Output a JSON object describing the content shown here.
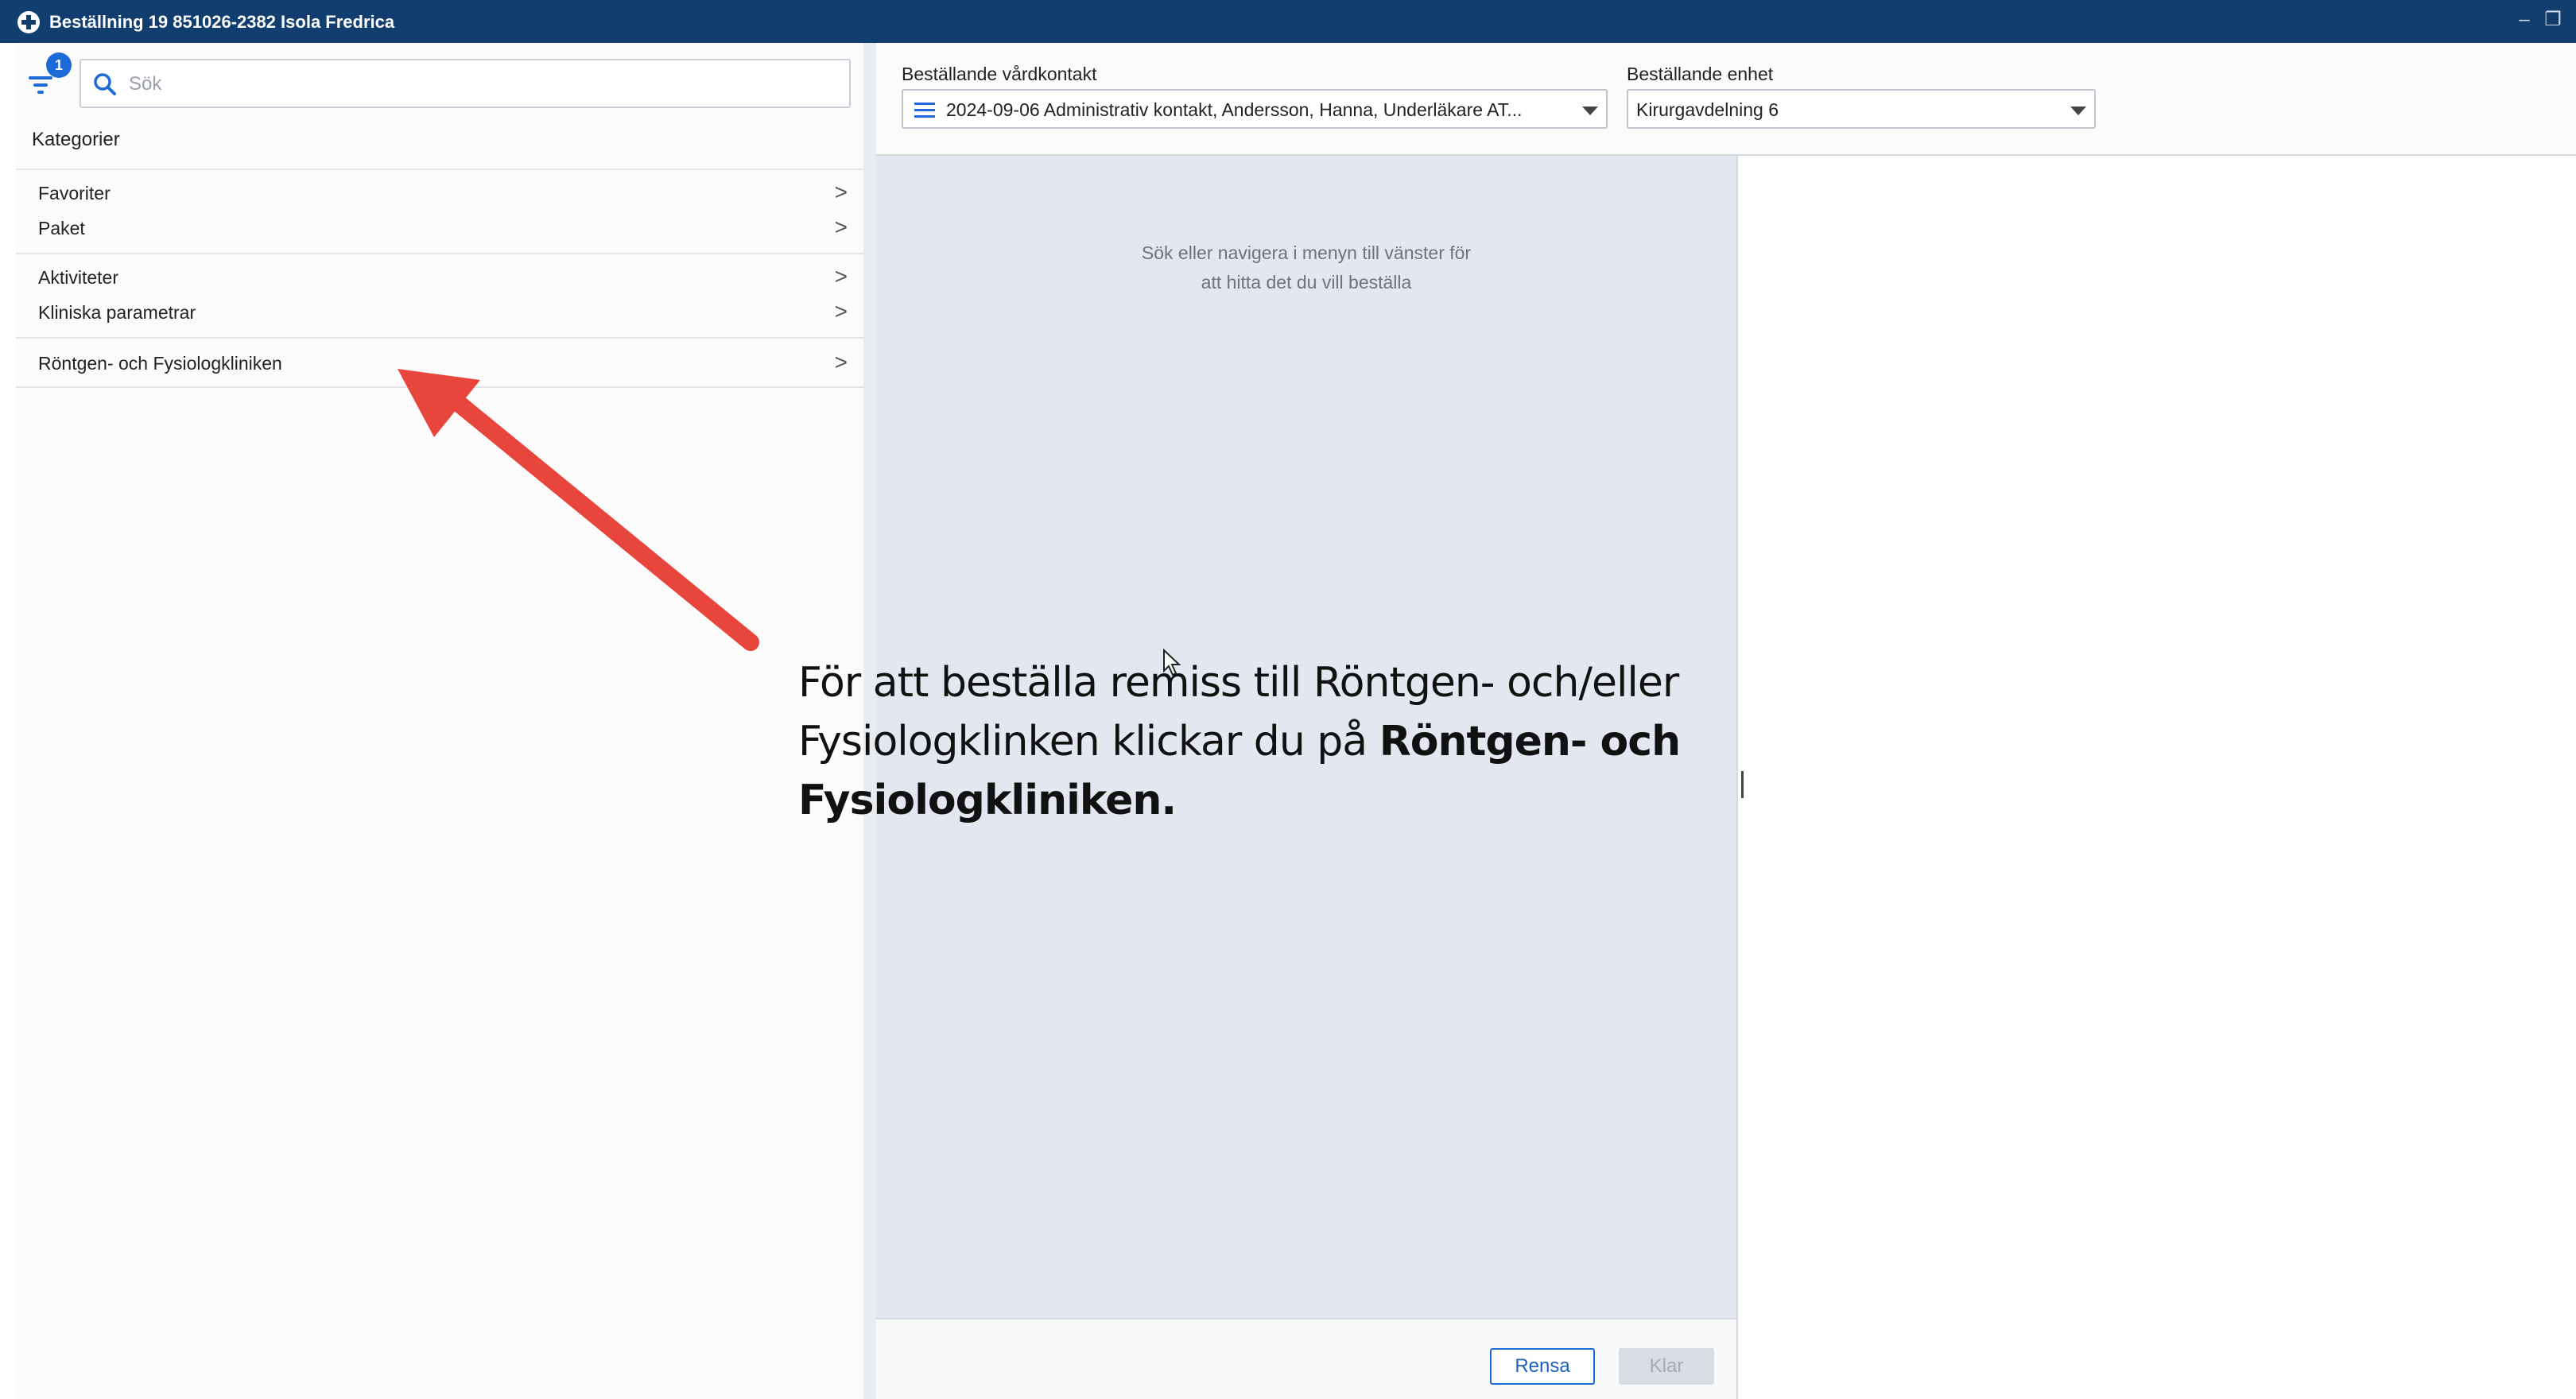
{
  "window": {
    "title": "Beställning 19 851026-2382 Isola Fredrica",
    "icon": "medical-cross-icon",
    "controls": {
      "minimize": "–",
      "restore": "❐"
    }
  },
  "left": {
    "filter_badge": "1",
    "search_placeholder": "Sök",
    "categories_title": "Kategorier",
    "groups": [
      {
        "items": [
          {
            "label": "Favoriter"
          },
          {
            "label": "Paket"
          }
        ]
      },
      {
        "items": [
          {
            "label": "Aktiviteter"
          },
          {
            "label": "Kliniska parametrar"
          }
        ]
      },
      {
        "items": [
          {
            "label": "Röntgen- och Fysiologkliniken"
          }
        ]
      }
    ],
    "chevron": ">"
  },
  "header": {
    "contact_label": "Beställande vårdkontakt",
    "contact_value": "2024-09-06 Administrativ kontakt, Andersson, Hanna, Underläkare AT...",
    "unit_label": "Beställande enhet",
    "unit_value": "Kirurgavdelning 6"
  },
  "center": {
    "hint_line1": "Sök eller navigera i menyn till vänster för",
    "hint_line2": "att hitta det du vill beställa"
  },
  "footer": {
    "clear_label": "Rensa",
    "done_label": "Klar"
  },
  "annotation": {
    "line1": "För att beställa remiss till Röntgen- och/eller",
    "line2_prefix": "Fysiologklinken klickar du på ",
    "line2_bold": "Röntgen- och",
    "line3_bold": "Fysiologkliniken."
  },
  "colors": {
    "titlebar": "#113e6e",
    "accent": "#1d6bd6",
    "arrow": "#e8453c",
    "center_pane": "#e3e8f0"
  }
}
